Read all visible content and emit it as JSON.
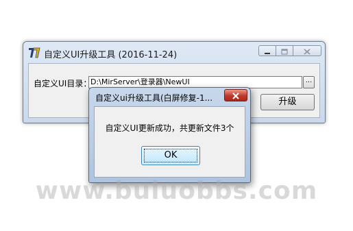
{
  "main_window": {
    "title": "自定义UI升级工具 (2016-11-24)",
    "icon": "app-logo-icon",
    "caption_buttons": [
      "minimize-icon",
      "maximize-icon",
      "close-icon"
    ],
    "dir_label": "自定义UI目录：",
    "path_value": "D:\\MirServer\\登录器\\NewUI",
    "browse_label": "...",
    "upgrade_label": "升级"
  },
  "message_box": {
    "title": "自定义ui升级工具(白屏修复-1...",
    "message": "自定义UI更新成功，共更新文件3个",
    "ok_label": "OK",
    "close_icon": "close-icon"
  },
  "watermark": {
    "text": "www.buluobbs.com"
  },
  "colors": {
    "frame": "#c9d9ec",
    "client": "#f0f0f0",
    "close_red": "#c0392b",
    "ok_blue": "#bee6fd"
  }
}
